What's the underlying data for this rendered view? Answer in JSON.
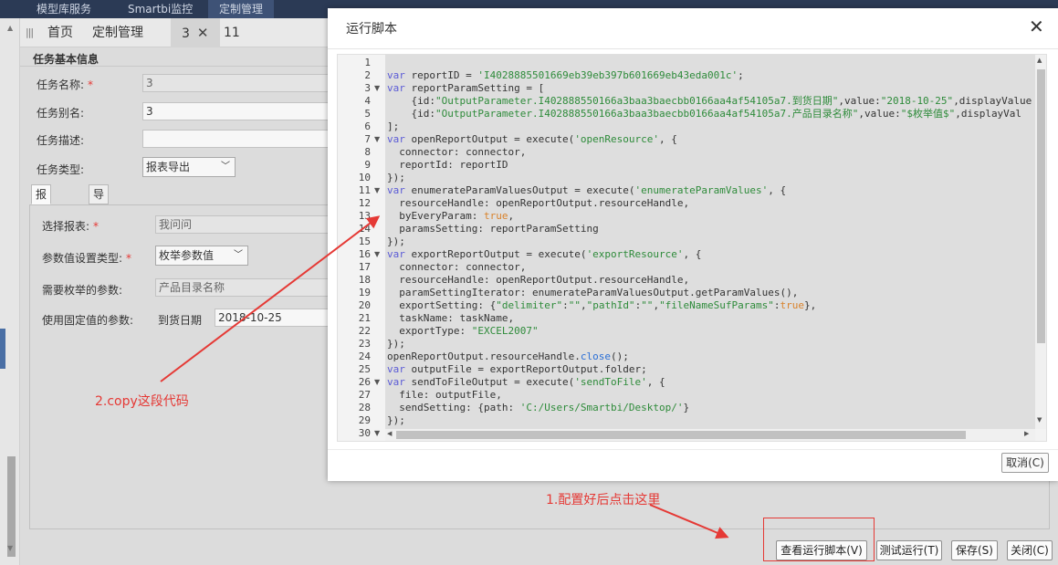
{
  "topnav": {
    "items": [
      "模型库服务",
      "Smartbi监控",
      "定制管理"
    ]
  },
  "tabs": {
    "items": [
      "首页",
      "定制管理",
      "3",
      "11"
    ],
    "active_index": 2
  },
  "form": {
    "section_title": "任务基本信息",
    "task_name_label": "任务名称:",
    "task_name_value": "3",
    "task_alias_label": "任务别名:",
    "task_alias_value": "3",
    "task_desc_label": "任务描述:",
    "task_desc_value": "",
    "task_type_label": "任务类型:",
    "task_type_value": "报表导出",
    "subtabs": [
      "报表设置",
      "导出设置"
    ],
    "select_report_label": "选择报表:",
    "select_report_value": "我问问",
    "param_type_label": "参数值设置类型:",
    "param_type_value": "枚举参数值",
    "enum_param_label": "需要枚举的参数:",
    "enum_param_value": "产品目录名称",
    "fixed_param_label": "使用固定值的参数:",
    "fixed_param_name": "到货日期",
    "fixed_param_value": "2018-10-25"
  },
  "bottom_buttons": {
    "view_script": "查看运行脚本(V)",
    "test_run": "测试运行(T)",
    "save": "保存(S)",
    "close": "关闭(C)"
  },
  "modal": {
    "title": "运行脚本",
    "cancel_label": "取消(C)",
    "code_lines": [
      [],
      [
        [
          "k",
          "var"
        ],
        [
          "d",
          " reportID = "
        ],
        [
          "s",
          "'I4028885501669eb39eb397b601669eb43eda001c'"
        ],
        [
          "d",
          ";"
        ]
      ],
      [
        [
          "k",
          "var"
        ],
        [
          "d",
          " reportParamSetting = ["
        ]
      ],
      [
        [
          "d",
          "    {id:"
        ],
        [
          "s",
          "\"OutputParameter.I402888550166a3baa3baecbb0166aa4af54105a7.到货日期\""
        ],
        [
          "d",
          ",value:"
        ],
        [
          "s",
          "\"2018-10-25\""
        ],
        [
          "d",
          ",displayValue"
        ]
      ],
      [
        [
          "d",
          "    {id:"
        ],
        [
          "s",
          "\"OutputParameter.I402888550166a3baa3baecbb0166aa4af54105a7.产品目录名称\""
        ],
        [
          "d",
          ",value:"
        ],
        [
          "s",
          "\"$枚举值$\""
        ],
        [
          "d",
          ",displayVal"
        ]
      ],
      [
        [
          "d",
          "];"
        ]
      ],
      [
        [
          "k",
          "var"
        ],
        [
          "d",
          " openReportOutput = execute("
        ],
        [
          "s",
          "'openResource'"
        ],
        [
          "d",
          ", {"
        ]
      ],
      [
        [
          "d",
          "  connector: connector,"
        ]
      ],
      [
        [
          "d",
          "  reportId: reportID"
        ]
      ],
      [
        [
          "d",
          "});"
        ]
      ],
      [
        [
          "k",
          "var"
        ],
        [
          "d",
          " enumerateParamValuesOutput = execute("
        ],
        [
          "s",
          "'enumerateParamValues'"
        ],
        [
          "d",
          ", {"
        ]
      ],
      [
        [
          "d",
          "  resourceHandle: openReportOutput.resourceHandle,"
        ]
      ],
      [
        [
          "d",
          "  byEveryParam: "
        ],
        [
          "b",
          "true"
        ],
        [
          "d",
          ","
        ]
      ],
      [
        [
          "d",
          "  paramsSetting: reportParamSetting"
        ]
      ],
      [
        [
          "d",
          "});"
        ]
      ],
      [
        [
          "k",
          "var"
        ],
        [
          "d",
          " exportReportOutput = execute("
        ],
        [
          "s",
          "'exportResource'"
        ],
        [
          "d",
          ", {"
        ]
      ],
      [
        [
          "d",
          "  connector: connector,"
        ]
      ],
      [
        [
          "d",
          "  resourceHandle: openReportOutput.resourceHandle,"
        ]
      ],
      [
        [
          "d",
          "  paramSettingIterator: enumerateParamValuesOutput.getParamValues(),"
        ]
      ],
      [
        [
          "d",
          "  exportSetting: {"
        ],
        [
          "s",
          "\"delimiter\""
        ],
        [
          "d",
          ":"
        ],
        [
          "s",
          "\"\""
        ],
        [
          "d",
          ","
        ],
        [
          "s",
          "\"pathId\""
        ],
        [
          "d",
          ":"
        ],
        [
          "s",
          "\"\""
        ],
        [
          "d",
          ","
        ],
        [
          "s",
          "\"fileNameSufParams\""
        ],
        [
          "d",
          ":"
        ],
        [
          "b",
          "true"
        ],
        [
          "d",
          "},"
        ]
      ],
      [
        [
          "d",
          "  taskName: taskName,"
        ]
      ],
      [
        [
          "d",
          "  exportType: "
        ],
        [
          "s",
          "\"EXCEL2007\""
        ]
      ],
      [
        [
          "d",
          "});"
        ]
      ],
      [
        [
          "d",
          "openReportOutput.resourceHandle."
        ],
        [
          "f",
          "close"
        ],
        [
          "d",
          "();"
        ]
      ],
      [
        [
          "k",
          "var"
        ],
        [
          "d",
          " outputFile = exportReportOutput.folder;"
        ]
      ],
      [
        [
          "k",
          "var"
        ],
        [
          "d",
          " sendToFileOutput = execute("
        ],
        [
          "s",
          "'sendToFile'"
        ],
        [
          "d",
          ", {"
        ]
      ],
      [
        [
          "d",
          "  file: outputFile,"
        ]
      ],
      [
        [
          "d",
          "  sendSetting: {path: "
        ],
        [
          "s",
          "'C:/Users/Smartbi/Desktop/'"
        ],
        [
          "d",
          "}"
        ]
      ],
      [
        [
          "d",
          "});"
        ]
      ],
      []
    ],
    "fold_lines": [
      3,
      7,
      11,
      16,
      26,
      30
    ]
  },
  "annotations": {
    "step1": "1.配置好后点击这里",
    "step2": "2.copy这段代码"
  },
  "colors": {
    "keyword": "#5b5bd6",
    "string": "#2e8b3a",
    "boolean": "#d9822b",
    "function": "#2b6fd6",
    "annotation": "#e53935"
  }
}
